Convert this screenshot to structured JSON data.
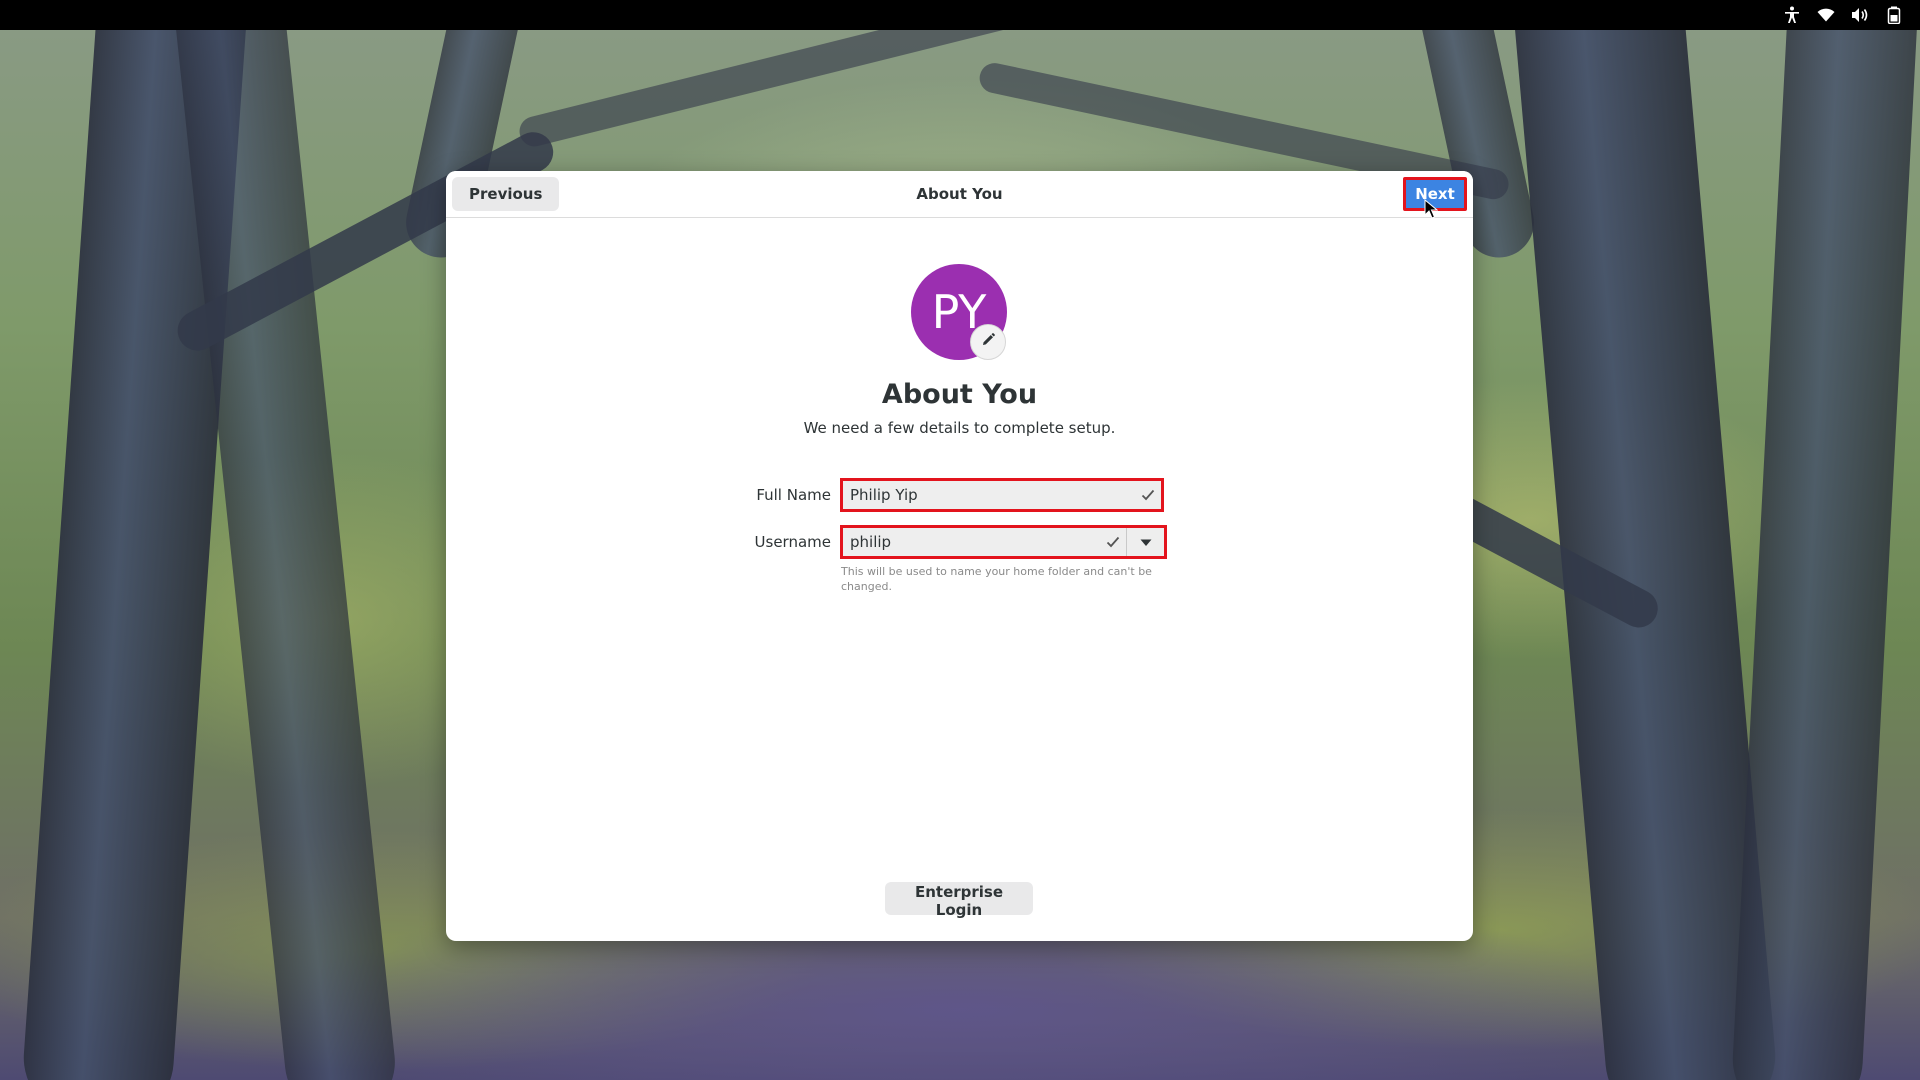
{
  "system_tray": {
    "icons": [
      "accessibility-icon",
      "wifi-icon",
      "volume-icon",
      "battery-icon"
    ]
  },
  "dialog": {
    "previous_label": "Previous",
    "title": "About You",
    "next_label": "Next"
  },
  "avatar": {
    "initials": "PY",
    "color": "#9b2fb0",
    "edit_icon": "pencil-icon"
  },
  "page": {
    "heading": "About You",
    "subtitle": "We need a few details to complete setup."
  },
  "form": {
    "full_name": {
      "label": "Full Name",
      "value": "Philip Yip",
      "status_icon": "check-icon"
    },
    "username": {
      "label": "Username",
      "value": "philip",
      "status_icon": "check-icon",
      "dropdown_icon": "chevron-down-icon",
      "hint": "This will be used to name your home folder and can't be changed."
    }
  },
  "footer": {
    "enterprise_login_label": "Enterprise Login"
  },
  "colors": {
    "accent": "#3c84e2",
    "highlight_border": "#e3141d",
    "avatar": "#9b2fb0"
  }
}
